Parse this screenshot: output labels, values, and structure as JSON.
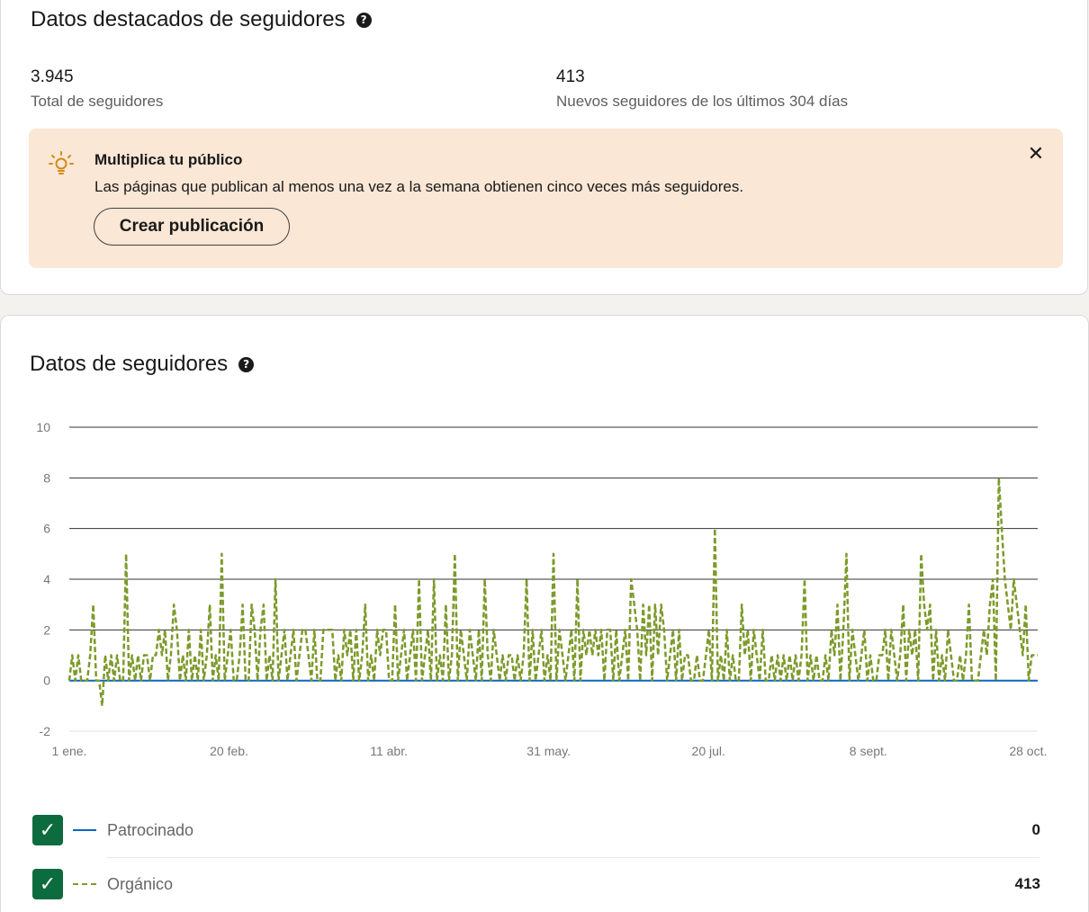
{
  "highlights": {
    "title": "Datos destacados de seguidores",
    "help_glyph": "?",
    "total_value": "3.945",
    "total_label": "Total de seguidores",
    "new_value": "413",
    "new_label": "Nuevos seguidores de los últimos 304 días"
  },
  "banner": {
    "icon": "lightbulb-icon",
    "title": "Multiplica tu público",
    "text": "Las páginas que publican al menos una vez a la semana obtienen cinco veces más seguidores.",
    "button_label": "Crear publicación",
    "close_glyph": "✕",
    "background": "#fae7d5"
  },
  "followers": {
    "title": "Datos de seguidores",
    "help_glyph": "?"
  },
  "chart_data": {
    "type": "line",
    "x_tick_labels": [
      "1 ene.",
      "20 feb.",
      "11 abr.",
      "31 may.",
      "20 jul.",
      "8 sept.",
      "28 oct."
    ],
    "x_tick_days": [
      0,
      50,
      100,
      150,
      200,
      250,
      300
    ],
    "y_ticks": [
      "10",
      "8",
      "6",
      "4",
      "2",
      "0",
      "-2"
    ],
    "ylim": [
      -2,
      10
    ],
    "xlim_days": [
      0,
      303
    ],
    "grid": true,
    "series": [
      {
        "name": "Patrocinado",
        "style": "solid",
        "color": "#0a66c2",
        "values": [
          0,
          0
        ]
      },
      {
        "name": "Orgánico",
        "style": "dashed",
        "color": "#7d9a2b",
        "values": [
          0,
          1,
          0,
          1,
          0,
          0,
          0,
          1,
          3,
          0,
          0,
          -1,
          1,
          0,
          1,
          0,
          1,
          0,
          0,
          5,
          0,
          1,
          0,
          1,
          0,
          1,
          1,
          0,
          1,
          1,
          2,
          1,
          2,
          0,
          1,
          3,
          2,
          0,
          1,
          0,
          2,
          0,
          1,
          0,
          2,
          0,
          1,
          3,
          0,
          1,
          0,
          5,
          0,
          1,
          2,
          0,
          0,
          1,
          3,
          0,
          0,
          3,
          2,
          0,
          2,
          3,
          0,
          1,
          0,
          4,
          0,
          1,
          2,
          0,
          1,
          2,
          0,
          1,
          2,
          2,
          1,
          0,
          2,
          0,
          0,
          2,
          2,
          2,
          2,
          0,
          1,
          0,
          2,
          1,
          2,
          0,
          2,
          0,
          1,
          3,
          0,
          1,
          0,
          2,
          1,
          2,
          2,
          0,
          0,
          3,
          0,
          1,
          2,
          0,
          1,
          2,
          0,
          4,
          0,
          1,
          2,
          0,
          4,
          0,
          1,
          0,
          3,
          0,
          1,
          5,
          0,
          2,
          1,
          0,
          2,
          1,
          0,
          2,
          0,
          4,
          1,
          0,
          2,
          1,
          0,
          1,
          0,
          1,
          1,
          0,
          1,
          0,
          1,
          4,
          0,
          2,
          0,
          1,
          2,
          0,
          1,
          0,
          5,
          0,
          2,
          1,
          0,
          1,
          2,
          0,
          4,
          0,
          2,
          1,
          2,
          1,
          2,
          1,
          2,
          0,
          2,
          2,
          0,
          2,
          0,
          1,
          2,
          0,
          4,
          3,
          2,
          0,
          3,
          1,
          3,
          0,
          3,
          1,
          3,
          2,
          0,
          1,
          2,
          0,
          2,
          0,
          1,
          1,
          0,
          0,
          1,
          0,
          0,
          1,
          2,
          0,
          6,
          0,
          1,
          0,
          2,
          0,
          1,
          0,
          0,
          3,
          1,
          2,
          0,
          2,
          1,
          0,
          2,
          0,
          0,
          1,
          0,
          1,
          0,
          1,
          0,
          1,
          0,
          1,
          0,
          1,
          4,
          0,
          1,
          0,
          1,
          0,
          0,
          1,
          0,
          2,
          1,
          3,
          0,
          2,
          5,
          0,
          2,
          1,
          0,
          1,
          2,
          0,
          1,
          0,
          0,
          1,
          1,
          2,
          0,
          2,
          1,
          0,
          1,
          3,
          0,
          2,
          1,
          2,
          0,
          5,
          3,
          2,
          3,
          0,
          2,
          0,
          1,
          0,
          2,
          1,
          0,
          0,
          1,
          0,
          1,
          3,
          0,
          0,
          0,
          1,
          2,
          1,
          3,
          4,
          0,
          8,
          6,
          4,
          3,
          2,
          4,
          3,
          2,
          1,
          3,
          0,
          1,
          1,
          1
        ]
      }
    ]
  },
  "legend": [
    {
      "label": "Patrocinado",
      "value": "0",
      "checked": true,
      "check_glyph": "✓"
    },
    {
      "label": "Orgánico",
      "value": "413",
      "checked": true,
      "check_glyph": "✓"
    }
  ]
}
